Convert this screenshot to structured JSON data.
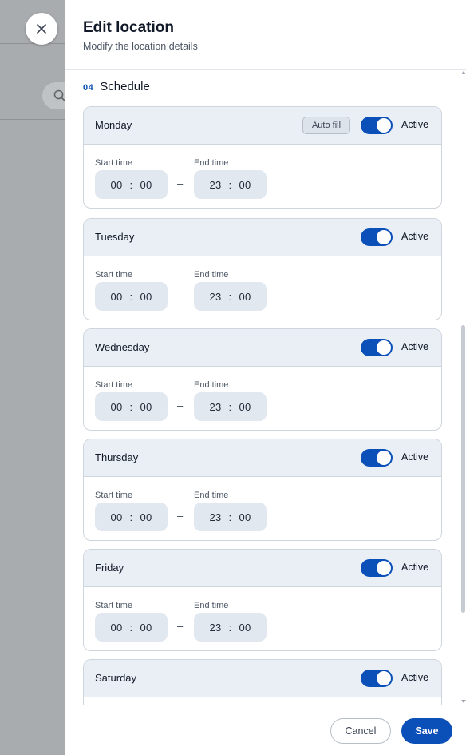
{
  "drawer": {
    "title": "Edit location",
    "subtitle": "Modify the location details"
  },
  "section": {
    "number": "04",
    "title": "Schedule"
  },
  "labels": {
    "autofill": "Auto fill",
    "active": "Active",
    "start_time": "Start time",
    "end_time": "End time",
    "dash": "–",
    "colon": ":"
  },
  "days": [
    {
      "name": "Monday",
      "active": true,
      "start": {
        "h": "00",
        "m": "00"
      },
      "end": {
        "h": "23",
        "m": "00"
      }
    },
    {
      "name": "Tuesday",
      "active": true,
      "start": {
        "h": "00",
        "m": "00"
      },
      "end": {
        "h": "23",
        "m": "00"
      }
    },
    {
      "name": "Wednesday",
      "active": true,
      "start": {
        "h": "00",
        "m": "00"
      },
      "end": {
        "h": "23",
        "m": "00"
      }
    },
    {
      "name": "Thursday",
      "active": true,
      "start": {
        "h": "00",
        "m": "00"
      },
      "end": {
        "h": "23",
        "m": "00"
      }
    },
    {
      "name": "Friday",
      "active": true,
      "start": {
        "h": "00",
        "m": "00"
      },
      "end": {
        "h": "23",
        "m": "00"
      }
    },
    {
      "name": "Saturday",
      "active": true
    }
  ],
  "footer": {
    "cancel_label": "Cancel",
    "save_label": "Save"
  },
  "colors": {
    "accent": "#0b4fb8",
    "card_header_bg": "#eaeff5",
    "time_box_bg": "#e2e8ef"
  },
  "icons": {
    "close": "close-icon",
    "search": "search-icon"
  }
}
